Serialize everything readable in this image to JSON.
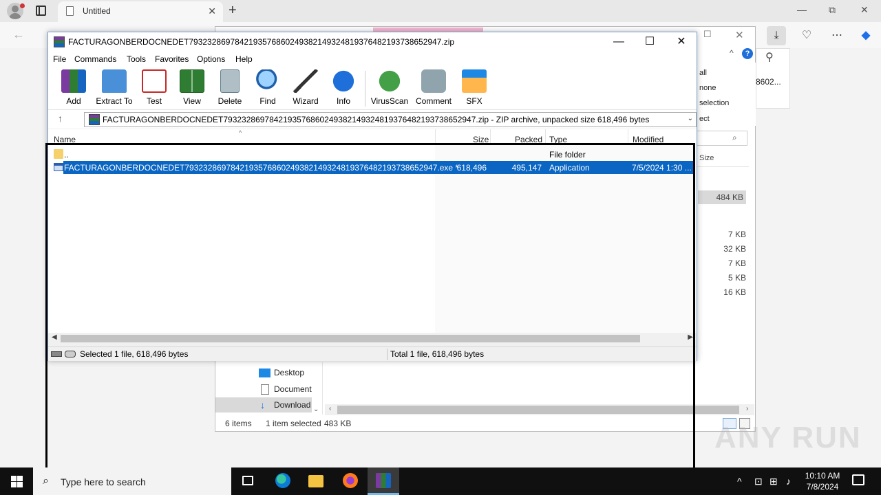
{
  "browser": {
    "tab_title": "Untitled",
    "tab_close": "✕",
    "new_tab": "+",
    "minimize": "—",
    "restore": "⧉",
    "close": "✕"
  },
  "background_explorer": {
    "ribbon_items": [
      "all",
      "none",
      "selection",
      "ect"
    ],
    "download_name": "8602...",
    "column_size": "Size",
    "sizes": [
      "484 KB",
      "7 KB",
      "32 KB",
      "7 KB",
      "5 KB",
      "16 KB"
    ],
    "nav_items": [
      "Desktop",
      "Document",
      "Download"
    ],
    "status_items_count": "6 items",
    "status_selected": "1 item selected",
    "status_size": "483 KB"
  },
  "winrar": {
    "title": "FACTURAGONBERDOCNEDET7932328697842193576860249382149324819376482193738652947.zip",
    "menus": [
      "File",
      "Commands",
      "Tools",
      "Favorites",
      "Options",
      "Help"
    ],
    "tools": [
      {
        "label": "Add",
        "icon": "add-icon"
      },
      {
        "label": "Extract To",
        "icon": "extract-icon"
      },
      {
        "label": "Test",
        "icon": "test-icon"
      },
      {
        "label": "View",
        "icon": "view-icon"
      },
      {
        "label": "Delete",
        "icon": "delete-icon"
      },
      {
        "label": "Find",
        "icon": "find-icon"
      },
      {
        "label": "Wizard",
        "icon": "wizard-icon"
      },
      {
        "label": "Info",
        "icon": "info-icon"
      },
      {
        "label": "VirusScan",
        "icon": "virusscan-icon"
      },
      {
        "label": "Comment",
        "icon": "comment-icon"
      },
      {
        "label": "SFX",
        "icon": "sfx-icon"
      }
    ],
    "address": "FACTURAGONBERDOCNEDET7932328697842193576860249382149324819376482193738652947.zip - ZIP archive, unpacked size 618,496 bytes",
    "columns": {
      "name": "Name",
      "size": "Size",
      "packed": "Packed",
      "type": "Type",
      "modified": "Modified"
    },
    "rows": [
      {
        "name": "..",
        "size": "",
        "packed": "",
        "type": "File folder",
        "modified": ""
      },
      {
        "name": "FACTURAGONBERDOCNEDET7932328697842193576860249382149324819376482193738652947.exe *",
        "size": "618,496",
        "packed": "495,147",
        "type": "Application",
        "modified": "7/5/2024 1:30 ..."
      }
    ],
    "status_left": "Selected 1 file, 618,496 bytes",
    "status_right": "Total 1 file, 618,496 bytes"
  },
  "taskbar": {
    "search_placeholder": "Type here to search",
    "time": "10:10 AM",
    "date": "7/8/2024"
  },
  "watermark": "ANY RUN",
  "colors": {
    "selection": "#0a66c2",
    "taskbar": "#101010",
    "accent": "#76b9ed"
  }
}
